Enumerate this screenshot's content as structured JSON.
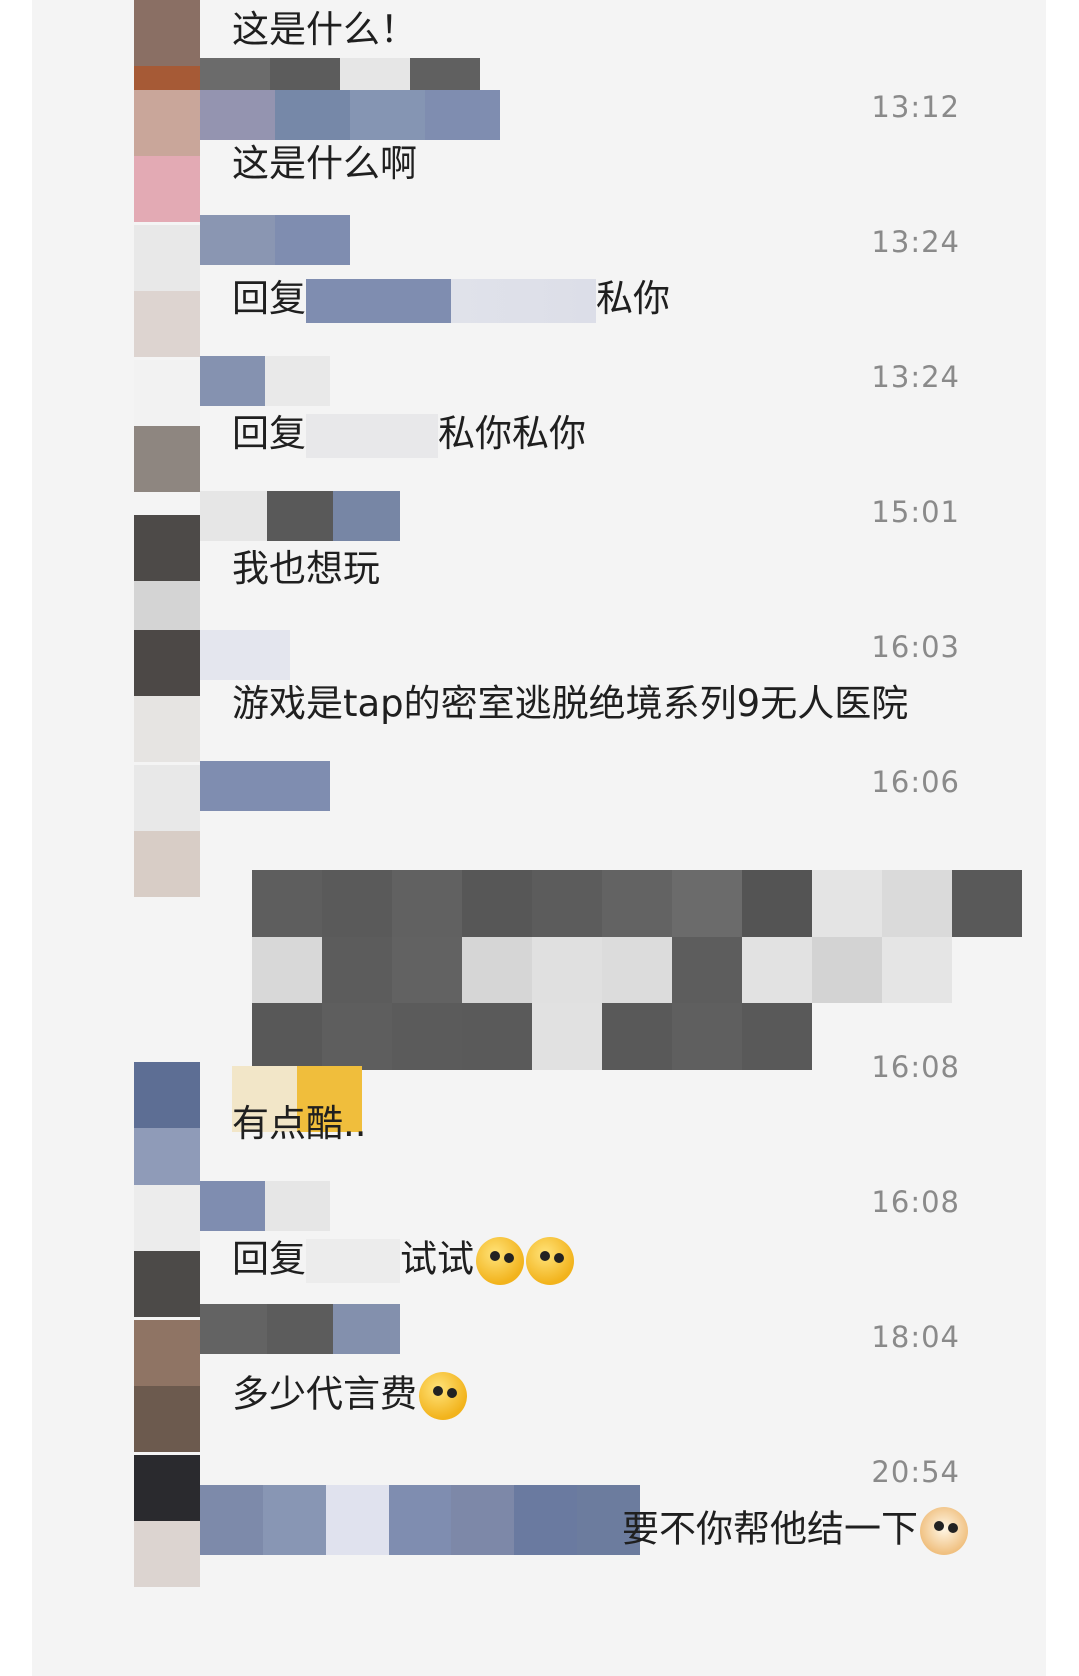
{
  "messages": [
    {
      "time": "",
      "text": "这是什么！"
    },
    {
      "time": "13:12",
      "text": "这是什么啊"
    },
    {
      "time": "13:24",
      "text_prefix": "回复",
      "text_suffix": "私你"
    },
    {
      "time": "13:24",
      "text_prefix": "回复",
      "text_suffix": "私你私你"
    },
    {
      "time": "15:01",
      "text": "我也想玩"
    },
    {
      "time": "16:03",
      "text": "游戏是tap的密室逃脱绝境系列9无人医院"
    },
    {
      "time": "16:06",
      "text": ""
    },
    {
      "time": "16:08",
      "text": "有点酷.."
    },
    {
      "time": "16:08",
      "text_prefix": "回复",
      "text_suffix": "试试"
    },
    {
      "time": "18:04",
      "text": "多少代言费"
    },
    {
      "time": "20:54",
      "text_suffix": "要不你帮他结一下"
    }
  ],
  "emoji": {
    "eye_cover": "eye-cover-emoji",
    "giggle": "giggle-emoji",
    "doge": "doge-emoji"
  },
  "colors": {
    "time": "#8a8a8a",
    "text": "#1f1f1f",
    "background": "#f4f4f4"
  }
}
